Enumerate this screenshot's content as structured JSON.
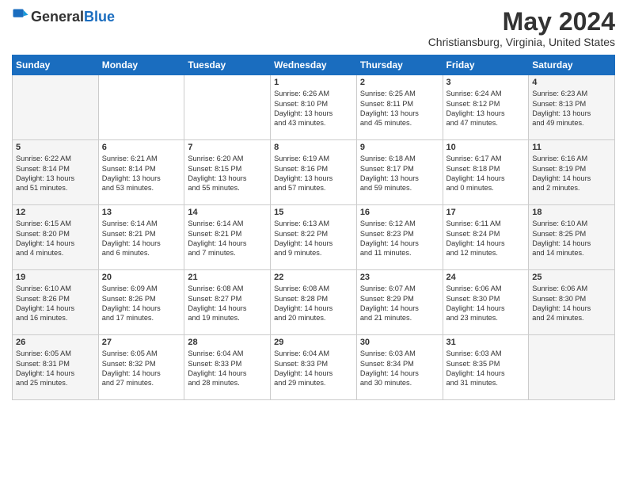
{
  "header": {
    "logo_general": "General",
    "logo_blue": "Blue",
    "month": "May 2024",
    "location": "Christiansburg, Virginia, United States"
  },
  "columns": [
    "Sunday",
    "Monday",
    "Tuesday",
    "Wednesday",
    "Thursday",
    "Friday",
    "Saturday"
  ],
  "weeks": [
    [
      {
        "day": "",
        "info": ""
      },
      {
        "day": "",
        "info": ""
      },
      {
        "day": "",
        "info": ""
      },
      {
        "day": "1",
        "info": "Sunrise: 6:26 AM\nSunset: 8:10 PM\nDaylight: 13 hours\nand 43 minutes."
      },
      {
        "day": "2",
        "info": "Sunrise: 6:25 AM\nSunset: 8:11 PM\nDaylight: 13 hours\nand 45 minutes."
      },
      {
        "day": "3",
        "info": "Sunrise: 6:24 AM\nSunset: 8:12 PM\nDaylight: 13 hours\nand 47 minutes."
      },
      {
        "day": "4",
        "info": "Sunrise: 6:23 AM\nSunset: 8:13 PM\nDaylight: 13 hours\nand 49 minutes."
      }
    ],
    [
      {
        "day": "5",
        "info": "Sunrise: 6:22 AM\nSunset: 8:14 PM\nDaylight: 13 hours\nand 51 minutes."
      },
      {
        "day": "6",
        "info": "Sunrise: 6:21 AM\nSunset: 8:14 PM\nDaylight: 13 hours\nand 53 minutes."
      },
      {
        "day": "7",
        "info": "Sunrise: 6:20 AM\nSunset: 8:15 PM\nDaylight: 13 hours\nand 55 minutes."
      },
      {
        "day": "8",
        "info": "Sunrise: 6:19 AM\nSunset: 8:16 PM\nDaylight: 13 hours\nand 57 minutes."
      },
      {
        "day": "9",
        "info": "Sunrise: 6:18 AM\nSunset: 8:17 PM\nDaylight: 13 hours\nand 59 minutes."
      },
      {
        "day": "10",
        "info": "Sunrise: 6:17 AM\nSunset: 8:18 PM\nDaylight: 14 hours\nand 0 minutes."
      },
      {
        "day": "11",
        "info": "Sunrise: 6:16 AM\nSunset: 8:19 PM\nDaylight: 14 hours\nand 2 minutes."
      }
    ],
    [
      {
        "day": "12",
        "info": "Sunrise: 6:15 AM\nSunset: 8:20 PM\nDaylight: 14 hours\nand 4 minutes."
      },
      {
        "day": "13",
        "info": "Sunrise: 6:14 AM\nSunset: 8:21 PM\nDaylight: 14 hours\nand 6 minutes."
      },
      {
        "day": "14",
        "info": "Sunrise: 6:14 AM\nSunset: 8:21 PM\nDaylight: 14 hours\nand 7 minutes."
      },
      {
        "day": "15",
        "info": "Sunrise: 6:13 AM\nSunset: 8:22 PM\nDaylight: 14 hours\nand 9 minutes."
      },
      {
        "day": "16",
        "info": "Sunrise: 6:12 AM\nSunset: 8:23 PM\nDaylight: 14 hours\nand 11 minutes."
      },
      {
        "day": "17",
        "info": "Sunrise: 6:11 AM\nSunset: 8:24 PM\nDaylight: 14 hours\nand 12 minutes."
      },
      {
        "day": "18",
        "info": "Sunrise: 6:10 AM\nSunset: 8:25 PM\nDaylight: 14 hours\nand 14 minutes."
      }
    ],
    [
      {
        "day": "19",
        "info": "Sunrise: 6:10 AM\nSunset: 8:26 PM\nDaylight: 14 hours\nand 16 minutes."
      },
      {
        "day": "20",
        "info": "Sunrise: 6:09 AM\nSunset: 8:26 PM\nDaylight: 14 hours\nand 17 minutes."
      },
      {
        "day": "21",
        "info": "Sunrise: 6:08 AM\nSunset: 8:27 PM\nDaylight: 14 hours\nand 19 minutes."
      },
      {
        "day": "22",
        "info": "Sunrise: 6:08 AM\nSunset: 8:28 PM\nDaylight: 14 hours\nand 20 minutes."
      },
      {
        "day": "23",
        "info": "Sunrise: 6:07 AM\nSunset: 8:29 PM\nDaylight: 14 hours\nand 21 minutes."
      },
      {
        "day": "24",
        "info": "Sunrise: 6:06 AM\nSunset: 8:30 PM\nDaylight: 14 hours\nand 23 minutes."
      },
      {
        "day": "25",
        "info": "Sunrise: 6:06 AM\nSunset: 8:30 PM\nDaylight: 14 hours\nand 24 minutes."
      }
    ],
    [
      {
        "day": "26",
        "info": "Sunrise: 6:05 AM\nSunset: 8:31 PM\nDaylight: 14 hours\nand 25 minutes."
      },
      {
        "day": "27",
        "info": "Sunrise: 6:05 AM\nSunset: 8:32 PM\nDaylight: 14 hours\nand 27 minutes."
      },
      {
        "day": "28",
        "info": "Sunrise: 6:04 AM\nSunset: 8:33 PM\nDaylight: 14 hours\nand 28 minutes."
      },
      {
        "day": "29",
        "info": "Sunrise: 6:04 AM\nSunset: 8:33 PM\nDaylight: 14 hours\nand 29 minutes."
      },
      {
        "day": "30",
        "info": "Sunrise: 6:03 AM\nSunset: 8:34 PM\nDaylight: 14 hours\nand 30 minutes."
      },
      {
        "day": "31",
        "info": "Sunrise: 6:03 AM\nSunset: 8:35 PM\nDaylight: 14 hours\nand 31 minutes."
      },
      {
        "day": "",
        "info": ""
      }
    ]
  ]
}
